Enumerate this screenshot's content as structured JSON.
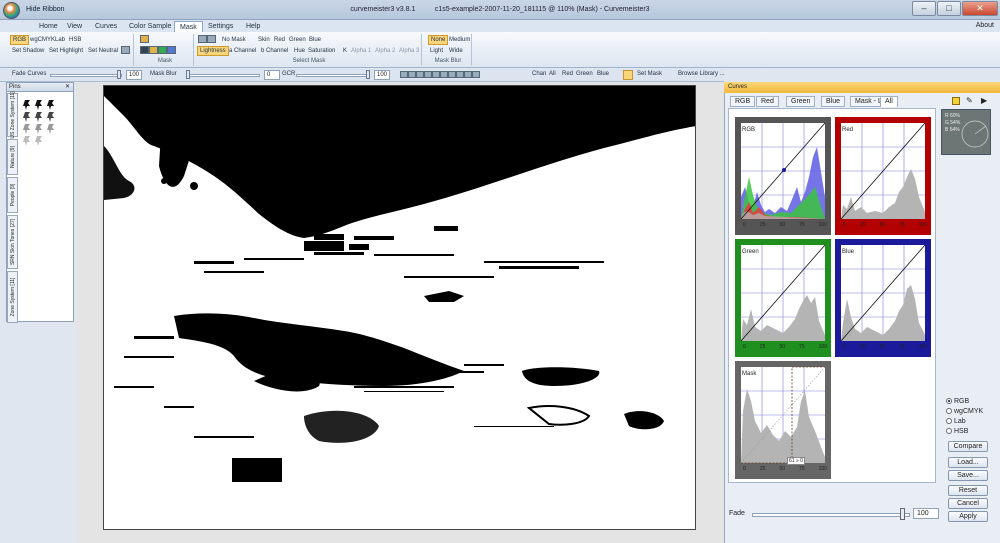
{
  "window": {
    "hide_ribbon": "Hide Ribbon",
    "title": "curvemeister3 v3.8.1          c1s5-example2-2007-11-20_181115 @ 110% (Mask) - Curvemeister3",
    "minimize": "–",
    "maximize": "□",
    "close": "✕"
  },
  "menu": {
    "tabs": [
      "Home",
      "View",
      "Curves",
      "Color Sample",
      "Mask",
      "Settings",
      "Help"
    ],
    "active": "Mask",
    "about": "About"
  },
  "ribbon": {
    "row1": [
      "RGB",
      "wgCMYK",
      "Lab",
      "HSB"
    ],
    "row2": [
      "Set Shadow",
      "Set Highlight",
      "Set Neutral"
    ],
    "mask_caption": "Mask",
    "no_mask": "No Mask",
    "mask_row1": [
      "Skin",
      "Red",
      "Green",
      "Blue"
    ],
    "mask_row2": [
      "Lightness",
      "a Channel",
      "b Channel",
      "Hue",
      "Saturation"
    ],
    "k_btn": "K",
    "alpha": [
      "Alpha 1",
      "Alpha 2",
      "Alpha 3"
    ],
    "select_mask_caption": "Select Mask",
    "blur_row1": [
      "None",
      "Medium"
    ],
    "blur_row2": [
      "Light",
      "Wide"
    ],
    "mask_blur_caption": "Mask Blur"
  },
  "toolbar": {
    "fade_curves": "Fade Curves",
    "fade_value": "100",
    "mask_blur": "Mask Blur",
    "mask_blur_value": "0",
    "gcr": "GCR",
    "gcr_value": "100",
    "channels": [
      "Chan",
      "All",
      "Red",
      "Green",
      "Blue"
    ],
    "set_mask": "Set Mask",
    "browse_library": "Browse Library ..."
  },
  "pins": {
    "title": "Pins",
    "tabs": [
      "US Zone System [11]",
      "Nature [9]",
      "People [9]",
      "SRN Skin Tones [27]",
      "Zone System [11]"
    ]
  },
  "curves": {
    "title": "Curves",
    "tabs": [
      "RGB",
      "Red",
      "Green",
      "Blue",
      "Mask - L",
      "All"
    ],
    "active_tab": "All",
    "boxes": [
      {
        "label": "RGB"
      },
      {
        "label": "Red"
      },
      {
        "label": "Green"
      },
      {
        "label": "Blue"
      },
      {
        "label": "Mask"
      }
    ],
    "tick_labels": [
      "0",
      "25",
      "50",
      "75",
      "100"
    ],
    "mask_readout": "61 » 0",
    "readout": [
      "R  60%",
      "G  54%",
      "B  54%"
    ],
    "modes": [
      "RGB",
      "wgCMYK",
      "Lab",
      "HSB"
    ],
    "active_mode": "RGB",
    "buttons": [
      "Compare",
      "Load...",
      "Save...",
      "Reset",
      "Cancel",
      "Apply"
    ],
    "fade_label": "Fade",
    "fade_value": "100",
    "fade_level": 0.95
  },
  "colors": {
    "rgb_frame": "#555555",
    "red_frame": "#b30000",
    "green_frame": "#1f8f1f",
    "blue_frame": "#1a1a9a",
    "mask_frame": "#666666"
  }
}
